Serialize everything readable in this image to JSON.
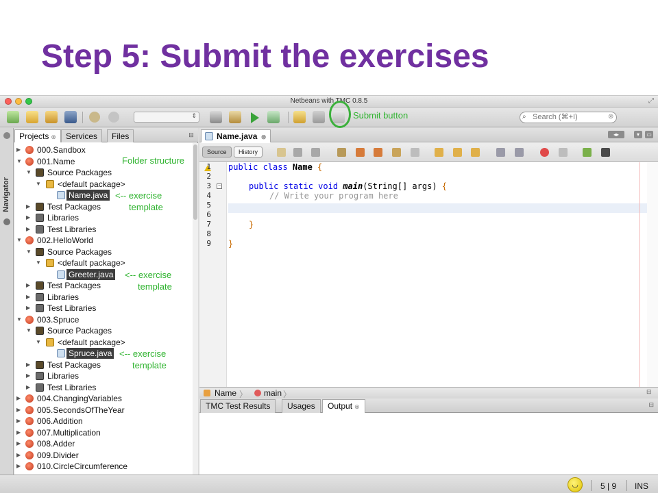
{
  "slide": {
    "title": "Step 5: Submit the exercises"
  },
  "window": {
    "title": "Netbeans with TMC 0.8.5"
  },
  "toolbar": {
    "search_placeholder": "Search (⌘+I)",
    "annotation_submit": "Submit button"
  },
  "sidebar": {
    "navigator_label": "Navigator"
  },
  "project_panel": {
    "tabs": [
      {
        "label": "Projects"
      },
      {
        "label": "Services"
      },
      {
        "label": "Files"
      }
    ],
    "tree": [
      {
        "label": "000.Sandbox"
      },
      {
        "label": "001.Name"
      },
      {
        "label": "Source Packages"
      },
      {
        "label": "<default package>"
      },
      {
        "label": "Name.java"
      },
      {
        "label": "Test Packages"
      },
      {
        "label": "Libraries"
      },
      {
        "label": "Test Libraries"
      },
      {
        "label": "002.HelloWorld"
      },
      {
        "label": "Source Packages"
      },
      {
        "label": "<default package>"
      },
      {
        "label": "Greeter.java"
      },
      {
        "label": "Test Packages"
      },
      {
        "label": "Libraries"
      },
      {
        "label": "Test Libraries"
      },
      {
        "label": "003.Spruce"
      },
      {
        "label": "Source Packages"
      },
      {
        "label": "<default package>"
      },
      {
        "label": "Spruce.java"
      },
      {
        "label": "Test Packages"
      },
      {
        "label": "Libraries"
      },
      {
        "label": "Test Libraries"
      },
      {
        "label": "004.ChangingVariables"
      },
      {
        "label": "005.SecondsOfTheYear"
      },
      {
        "label": "006.Addition"
      },
      {
        "label": "007.Multiplication"
      },
      {
        "label": "008.Adder"
      },
      {
        "label": "009.Divider"
      },
      {
        "label": "010.CircleCircumference"
      }
    ],
    "annotations": {
      "folder": "Folder structure",
      "exercise_arrow": "<-- exercise",
      "template": "template"
    }
  },
  "editor": {
    "tab_label": "Name.java",
    "source_label": "Source",
    "history_label": "History",
    "line_numbers": [
      "1",
      "2",
      "3",
      "4",
      "5",
      "6",
      "7",
      "8",
      "9"
    ],
    "code": {
      "l1_kw": "public class ",
      "l1_name": "Name",
      "l1_brace": " {",
      "l3_kw": "public static void ",
      "l3_method": "main",
      "l3_args": "(String[] args) ",
      "l3_brace": "{",
      "l4_comment": "// Write your program here",
      "l7_brace": "}",
      "l9_brace": "}"
    },
    "breadcrumbs": [
      "Name",
      "main"
    ]
  },
  "output_panel": {
    "tabs": [
      {
        "label": "TMC Test Results"
      },
      {
        "label": "Usages"
      },
      {
        "label": "Output"
      }
    ]
  },
  "statusbar": {
    "position": "5 | 9",
    "mode": "INS"
  },
  "colors": {
    "title": "#7030a0",
    "annotation": "#2fb32f",
    "keyword": "#0000e6"
  }
}
